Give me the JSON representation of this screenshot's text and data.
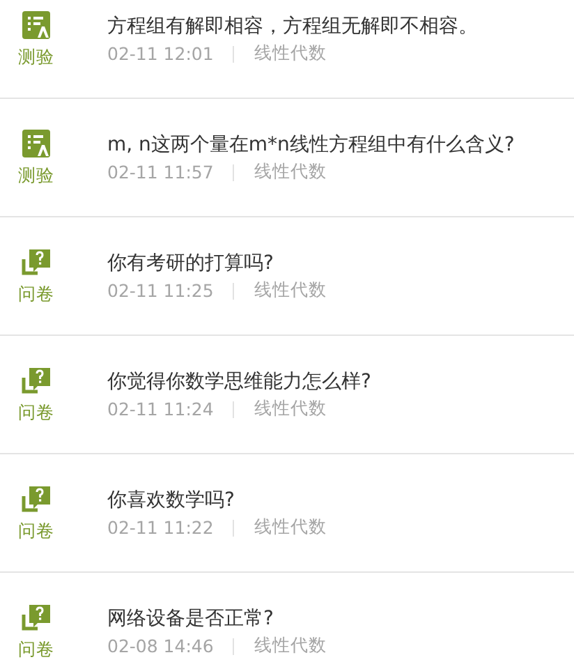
{
  "items": [
    {
      "kind": "quiz",
      "type_label": "测验",
      "title": "方程组有解即相容，方程组无解即不相容。",
      "time": "02-11 12:01",
      "course": "线性代数"
    },
    {
      "kind": "quiz",
      "type_label": "测验",
      "title": "m, n这两个量在m*n线性方程组中有什么含义?",
      "time": "02-11 11:57",
      "course": "线性代数"
    },
    {
      "kind": "survey",
      "type_label": "问卷",
      "title": "你有考研的打算吗?",
      "time": "02-11 11:25",
      "course": "线性代数"
    },
    {
      "kind": "survey",
      "type_label": "问卷",
      "title": "你觉得你数学思维能力怎么样?",
      "time": "02-11 11:24",
      "course": "线性代数"
    },
    {
      "kind": "survey",
      "type_label": "问卷",
      "title": "你喜欢数学吗?",
      "time": "02-11 11:22",
      "course": "线性代数"
    },
    {
      "kind": "survey",
      "type_label": "问卷",
      "title": "网络设备是否正常?",
      "time": "02-08 14:46",
      "course": "线性代数"
    }
  ]
}
